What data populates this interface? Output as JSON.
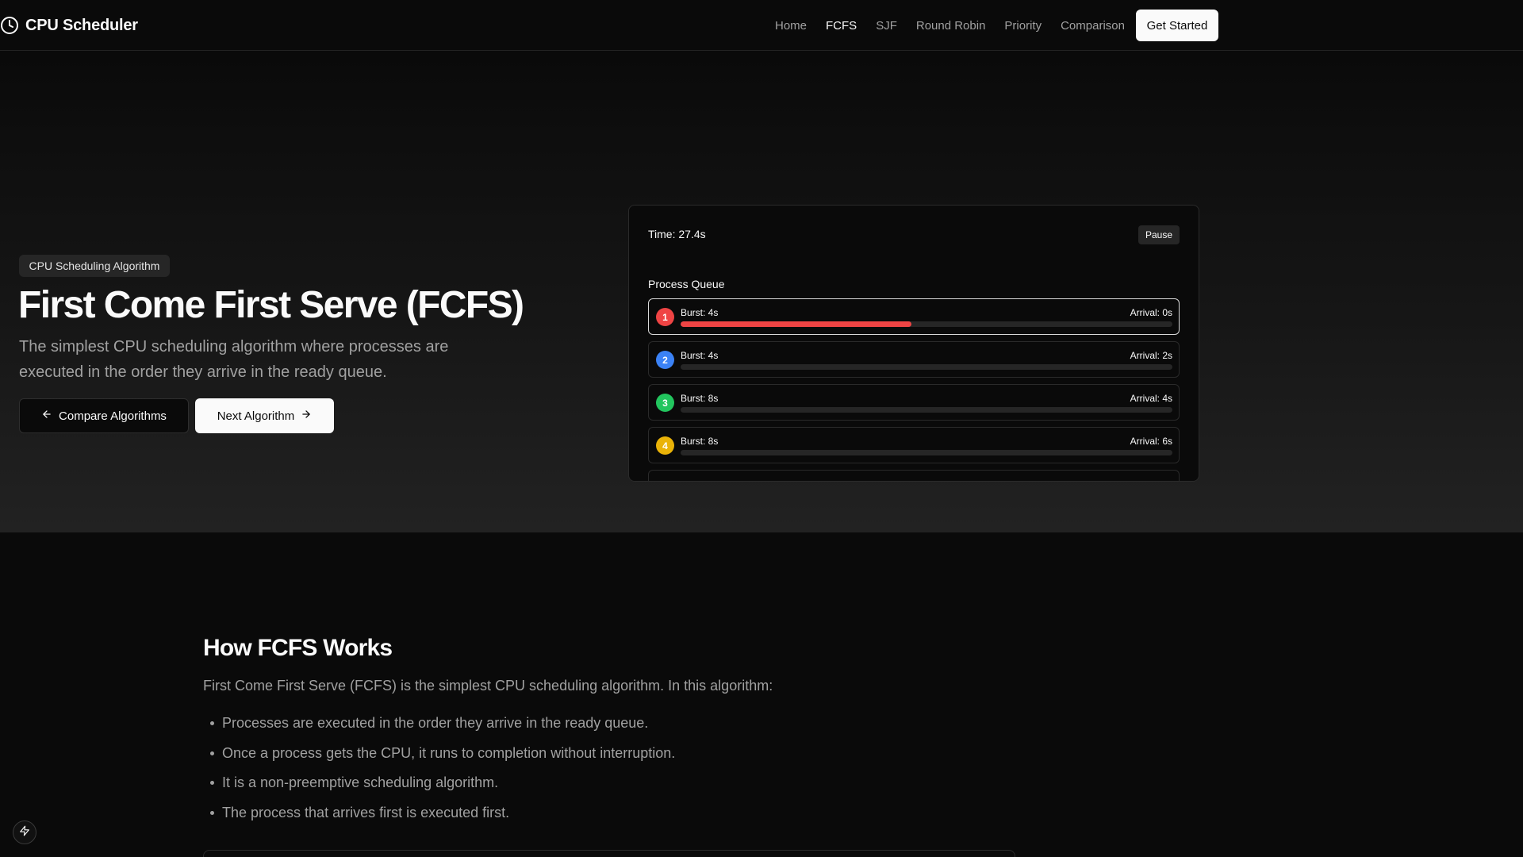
{
  "nav": {
    "brand": "CPU Scheduler",
    "links": [
      "Home",
      "FCFS",
      "SJF",
      "Round Robin",
      "Priority",
      "Comparison"
    ],
    "active_link": "FCFS",
    "cta": "Get Started"
  },
  "hero": {
    "badge": "CPU Scheduling Algorithm",
    "title": "First Come First Serve (FCFS)",
    "description": "The simplest CPU scheduling algorithm where processes are executed in the order they arrive in the ready queue.",
    "compare_button": "Compare Algorithms",
    "next_button": "Next Algorithm"
  },
  "simulation": {
    "time": "Time: 27.4s",
    "pause_label": "Pause",
    "queue_label": "Process Queue",
    "processes": [
      {
        "id": "1",
        "burst": "Burst: 4s",
        "arrival": "Arrival: 0s",
        "color": "#ef4444",
        "progress": 0.47,
        "active": true
      },
      {
        "id": "2",
        "burst": "Burst: 4s",
        "arrival": "Arrival: 2s",
        "color": "#3b82f6",
        "progress": 0,
        "active": false
      },
      {
        "id": "3",
        "burst": "Burst: 8s",
        "arrival": "Arrival: 4s",
        "color": "#22c55e",
        "progress": 0,
        "active": false
      },
      {
        "id": "4",
        "burst": "Burst: 8s",
        "arrival": "Arrival: 6s",
        "color": "#eab308",
        "progress": 0,
        "active": false
      }
    ]
  },
  "how": {
    "title": "How FCFS Works",
    "intro": "First Come First Serve (FCFS) is the simplest CPU scheduling algorithm. In this algorithm:",
    "points": [
      "Processes are executed in the order they arrive in the ready queue.",
      "Once a process gets the CPU, it runs to completion without interruption.",
      "It is a non-preemptive scheduling algorithm.",
      "The process that arrives first is executed first."
    ]
  },
  "icons": {
    "brand": "clock-icon",
    "compare": "arrow-left-icon",
    "next": "arrow-right-icon",
    "fab": "lightning-icon"
  }
}
